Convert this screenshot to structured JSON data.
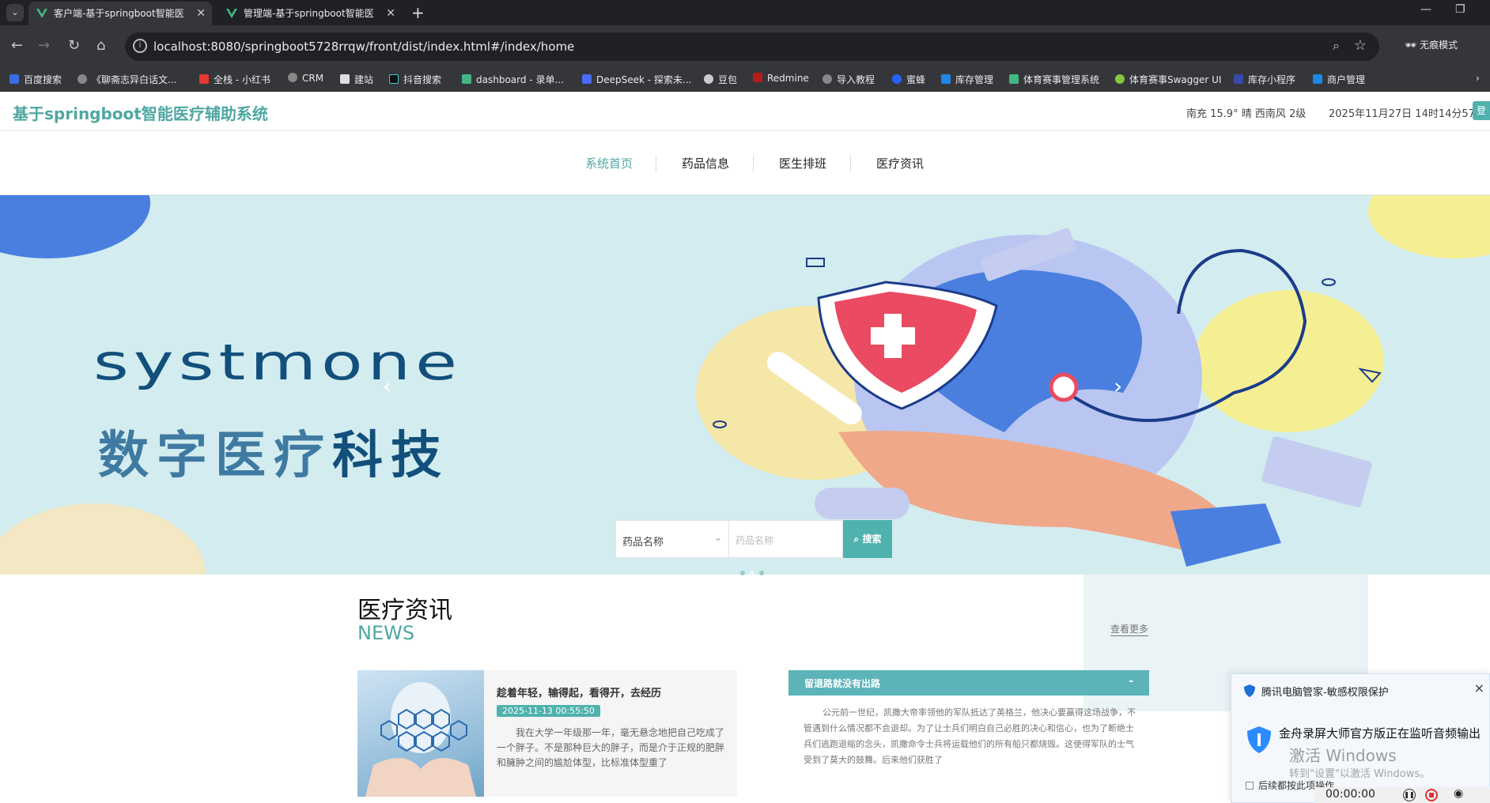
{
  "browser": {
    "tabs": [
      {
        "label": "客户端-基于springboot智能医",
        "active": true
      },
      {
        "label": "管理端-基于springboot智能医",
        "active": false
      }
    ],
    "new_tab": "+",
    "url": "localhost:8080/springboot5728rrqw/front/dist/index.html#/index/home",
    "incognito_label": "无痕模式",
    "bookmarks": [
      "百度搜索",
      "《聊斋志异白话文...",
      "全栈 - 小红书",
      "CRM",
      "建站",
      "抖音搜索",
      "dashboard - 录单...",
      "DeepSeek - 探索未...",
      "豆包",
      "Redmine",
      "导入教程",
      "蜜蜂",
      "库存管理",
      "体育赛事管理系统",
      "体育赛事Swagger UI",
      "库存小程序",
      "商户管理"
    ]
  },
  "header": {
    "site_title": "基于springboot智能医疗辅助系统",
    "weather": "南充  15.9°  晴  西南风  2级",
    "datetime": "2025年11月27日 14时14分57秒",
    "login_label": "登"
  },
  "nav": {
    "items": [
      "系统首页",
      "药品信息",
      "医生排班",
      "医疗资讯"
    ],
    "active_index": 0
  },
  "banner": {
    "brand": "systmone",
    "sub_left": "数字医疗",
    "sub_right": "科技",
    "prev": "‹",
    "next": "›",
    "slide_count": 3,
    "current_slide": 2
  },
  "search": {
    "select_value": "药品名称",
    "input_placeholder": "药品名称",
    "button_label": "⌕ 搜索"
  },
  "news": {
    "title": "医疗资讯",
    "subtitle": "NEWS",
    "more": "查看更多",
    "card": {
      "title": "趁着年轻，输得起，看得开，去经历",
      "date": "2025-11-13 00:55:50",
      "text": "我在大学一年级那一年，毫无悬念地把自己吃成了一个胖子。不是那种巨大的胖子，而是介于正规的肥胖和臃肿之间的尴尬体型，比标准体型重了"
    },
    "accordion": {
      "title": "留退路就没有出路",
      "toggle": "-",
      "text": "公元前一世纪，凯撒大帝率领他的军队抵达了英格兰，他决心要赢得这场战争，不管遇到什么情况都不会退却。为了让士兵们明白自己必胜的决心和信心，也为了断绝士兵们逃跑退缩的念头，凯撒命令士兵将运载他们的所有船只都烧毁。这使得军队的士气受到了莫大的鼓舞。后来他们获胜了"
    }
  },
  "popup": {
    "title": "腾讯电脑管家-敏感权限保护",
    "close": "×",
    "message": "金舟录屏大师官方版正在监听音频输出",
    "checkbox": "后续都按此项操作"
  },
  "watermark": {
    "line1": "激活 Windows",
    "line2": "转到\"设置\"以激活 Windows。"
  },
  "recorder": {
    "time": "00:00:00"
  }
}
